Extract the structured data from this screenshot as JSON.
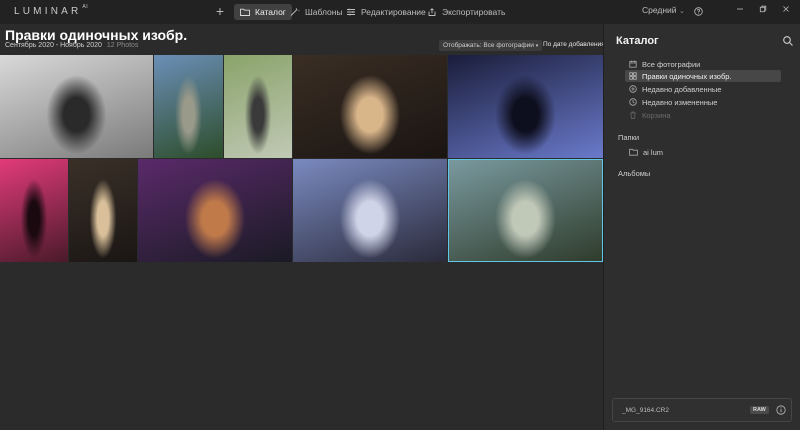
{
  "app": {
    "logo_text": "LUMINAR",
    "logo_sup": "AI"
  },
  "toolbar": {
    "tabs": [
      {
        "label": "Каталог",
        "icon": "folder-icon",
        "active": true
      },
      {
        "label": "Шаблоны",
        "icon": "wand-icon",
        "active": false
      },
      {
        "label": "Редактирование",
        "icon": "sliders-icon",
        "active": false
      },
      {
        "label": "Экспортировать",
        "icon": "export-icon",
        "active": false
      }
    ],
    "size_select": "Средний",
    "size_chevron": "⌄"
  },
  "header": {
    "title": "Правки одиночных изобр.",
    "date_range": "Сентябрь 2020 - Ноябрь 2020",
    "count": "12 Photos",
    "filter": "Отображать: Все фотографии",
    "sort": "По дате добавления"
  },
  "photos": [
    {
      "colors": [
        "#d9d9d9",
        "#7a7a7a",
        "#2a2a2a"
      ],
      "selected": false
    },
    {
      "colors": [
        "#6b8fb8",
        "#2d4d2a",
        "#9a9a8a"
      ],
      "selected": false
    },
    {
      "colors": [
        "#8aa36a",
        "#c0c9b5",
        "#3a3a3a"
      ],
      "selected": false
    },
    {
      "colors": [
        "#3a2e24",
        "#1a1412",
        "#d9b58a"
      ],
      "selected": false
    },
    {
      "colors": [
        "#1a1d3a",
        "#6a7acb",
        "#0e0f1e"
      ],
      "selected": false
    },
    {
      "colors": [
        "#e23b7a",
        "#4a1a2a",
        "#1a0a10"
      ],
      "selected": false
    },
    {
      "colors": [
        "#3a3028",
        "#1a1614",
        "#d9c09a"
      ],
      "selected": false
    },
    {
      "colors": [
        "#5a2a6a",
        "#1a1a24",
        "#c07a4a"
      ],
      "selected": false
    },
    {
      "colors": [
        "#7a8ac0",
        "#2a2a3a",
        "#d0d4e8"
      ],
      "selected": false
    },
    {
      "colors": [
        "#7a9aa0",
        "#2e3b2a",
        "#c0c8b8"
      ],
      "selected": true
    }
  ],
  "panel": {
    "title": "Каталог",
    "items": [
      {
        "label": "Все фотографии",
        "icon": "calendar-icon",
        "active": false,
        "dim": false
      },
      {
        "label": "Правки одиночных изобр.",
        "icon": "grid-icon",
        "active": true,
        "dim": false
      },
      {
        "label": "Недавно добавленные",
        "icon": "plus-circle-icon",
        "active": false,
        "dim": false
      },
      {
        "label": "Недавно измененные",
        "icon": "clock-icon",
        "active": false,
        "dim": false
      },
      {
        "label": "Корзина",
        "icon": "trash-icon",
        "active": false,
        "dim": true
      }
    ],
    "folders_title": "Папки",
    "folder": "ai lum",
    "albums_title": "Альбомы"
  },
  "file": {
    "name": "_MG_9164.CR2",
    "badge": "RAW"
  }
}
